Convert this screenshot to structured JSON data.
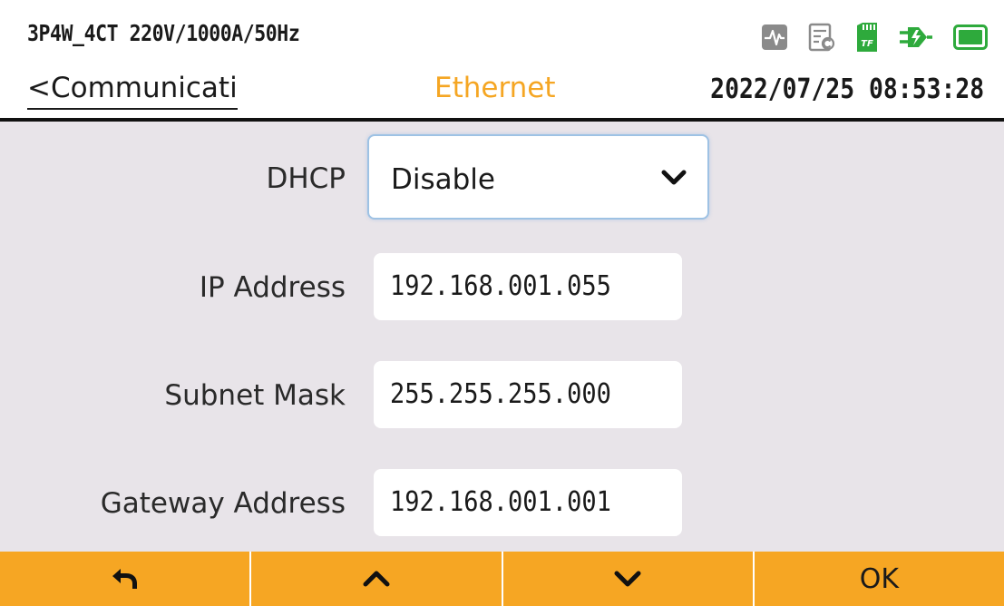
{
  "header": {
    "config": "3P4W_4CT 220V/1000A/50Hz",
    "back_label": "<Communicati",
    "title": "Ethernet",
    "datetime": "2022/07/25 08:53:28",
    "status_icons": [
      "waveform-icon",
      "report-icon",
      "tf-card-icon",
      "power-plug-icon",
      "battery-icon"
    ],
    "tf_label": "TF"
  },
  "form": {
    "dhcp": {
      "label": "DHCP",
      "value": "Disable"
    },
    "ip_address": {
      "label": "IP Address",
      "value": "192.168.001.055"
    },
    "subnet_mask": {
      "label": "Subnet Mask",
      "value": "255.255.255.000"
    },
    "gateway": {
      "label": "Gateway Address",
      "value": "192.168.001.001"
    }
  },
  "softkeys": {
    "back_icon": "return-arrow-icon",
    "up_icon": "chevron-up-icon",
    "down_icon": "chevron-down-icon",
    "ok_label": "OK"
  },
  "colors": {
    "accent": "#f6a623",
    "title": "#f5a623",
    "form_background": "#e8e4e9",
    "tf_green": "#2eaa3c",
    "status_gray": "#8a8a8a"
  }
}
